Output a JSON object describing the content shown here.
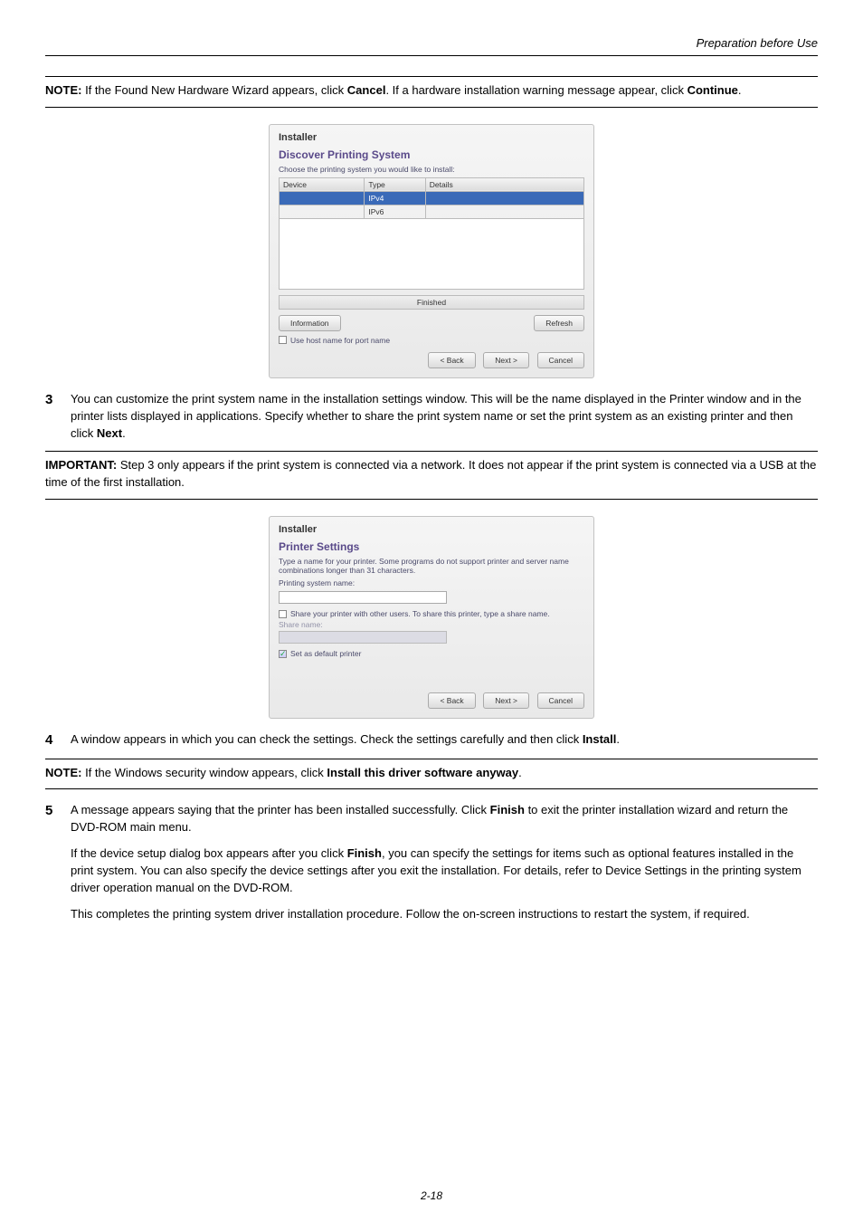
{
  "header": {
    "section": "Preparation before Use"
  },
  "note1": {
    "label": "NOTE:",
    "text_a": " If the Found New Hardware Wizard appears, click ",
    "cancel": "Cancel",
    "text_b": ". If a hardware installation warning message appear, click ",
    "continue": "Continue",
    "text_c": "."
  },
  "dialog1": {
    "installer": "Installer",
    "heading": "Discover Printing System",
    "choose": "Choose the printing system you would like to install:",
    "cols": {
      "device": "Device",
      "type": "Type",
      "details": "Details"
    },
    "rows": {
      "r1type": "IPv4",
      "r2type": "IPv6"
    },
    "status": "Finished",
    "info": "Information",
    "refresh": "Refresh",
    "use_host": "Use host name for port name",
    "back": "< Back",
    "next": "Next >",
    "cancel": "Cancel"
  },
  "step3": {
    "num": "3",
    "text_a": "You can customize the print system name in the installation settings window. This will be the name displayed in the Printer window and in the printer lists displayed in applications. Specify whether to share the print system name or set the print system as an existing printer and then click ",
    "next": "Next",
    "text_b": "."
  },
  "important": {
    "label": "IMPORTANT:",
    "text": " Step 3 only appears if the print system is connected via a network. It does not appear if the print system is connected via a USB at the time of the first installation."
  },
  "dialog2": {
    "installer": "Installer",
    "heading": "Printer Settings",
    "desc": "Type a name for your printer. Some programs do not support printer and server name combinations longer than 31 characters.",
    "psn": "Printing system name:",
    "share_chk": "Share your printer with other users. To share this printer, type a share name.",
    "share_lbl": "Share name:",
    "default_chk": "Set as default printer",
    "back": "< Back",
    "next": "Next >",
    "cancel": "Cancel"
  },
  "step4": {
    "num": "4",
    "text_a": "A window appears in which you can check the settings. Check the settings carefully and then click ",
    "install": "Install",
    "text_b": "."
  },
  "note2": {
    "label": "NOTE:",
    "text_a": " If the Windows security window appears, click ",
    "anyway": "Install this driver software anyway",
    "text_b": "."
  },
  "step5": {
    "num": "5",
    "p1a": "A message appears saying that the printer has been installed successfully. Click ",
    "finish": "Finish",
    "p1b": " to exit the printer installation wizard and return the DVD-ROM main menu.",
    "p2a": "If the device setup dialog box appears after you click ",
    "p2b": ", you can specify the settings for items such as optional features installed in the print system. You can also specify the device settings after you exit the installation. For details, refer to Device Settings in the printing system driver operation manual on the DVD-ROM.",
    "p3": "This completes the printing system driver installation procedure. Follow the on-screen instructions to restart the system, if required."
  },
  "footer": {
    "pagenum": "2-18"
  }
}
